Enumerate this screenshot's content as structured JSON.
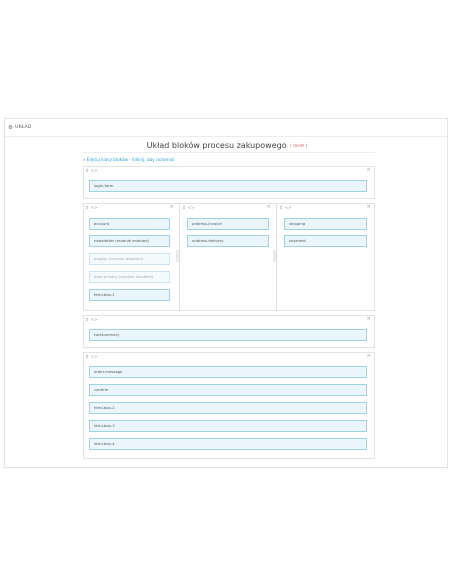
{
  "panel": {
    "title": "UKŁAD",
    "gear_icon": "gear-icon"
  },
  "heading": {
    "title": "Układ bloków procesu zakupowego",
    "reset": "( reset )"
  },
  "edit_link": {
    "arrow": "»",
    "label": "Edytuj klasy bloków - kliknij, aby rozwinąć"
  },
  "controls": {
    "move": "⇕",
    "code": "<>",
    "close": "×"
  },
  "blocks": {
    "login": [
      "login-form"
    ],
    "col1": [
      "account",
      "newsletter (module enabled)",
      "pagdpr (module disabled)",
      "data privacy (module disabled)",
      "html-box-1"
    ],
    "col2": [
      "address-invoice",
      "address-delivery"
    ],
    "col3": [
      "shipping",
      "payment"
    ],
    "cart": [
      "cartsummary"
    ],
    "final": [
      "order-message",
      "confirm",
      "html-box-2",
      "html-box-3",
      "html-box-4"
    ]
  }
}
